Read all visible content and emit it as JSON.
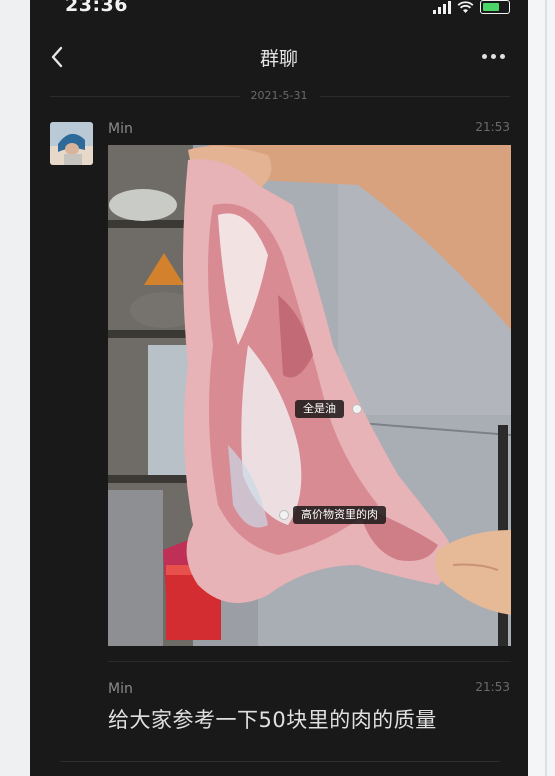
{
  "status_bar": {
    "time": "23:36"
  },
  "nav": {
    "title": "群聊"
  },
  "date_divider": "2021-5-31",
  "messages": [
    {
      "sender": "Min",
      "time": "21:53",
      "type": "image",
      "annotations": [
        {
          "text": "全是油"
        },
        {
          "text": "高价物资里的肉"
        }
      ]
    },
    {
      "sender": "Min",
      "time": "21:53",
      "type": "text",
      "text": "给大家参考一下50块里的肉的质量"
    }
  ],
  "icons": {
    "back": "chevron-left-icon",
    "more": "more-dots-icon",
    "signal": "signal-icon",
    "wifi": "wifi-icon",
    "battery": "battery-icon"
  },
  "colors": {
    "background": "#191919",
    "battery_fill": "#4bd468"
  }
}
